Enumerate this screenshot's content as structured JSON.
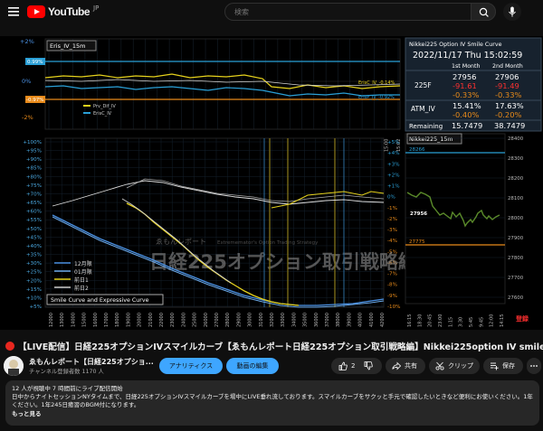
{
  "header": {
    "logo_text": "YouTube",
    "region": "JP",
    "search_placeholder": "検索"
  },
  "video": {
    "title": "【LIVE配信】日経225オプションIVスマイルカーブ【ゑもんレポート日経225オプション取引戦略編】Nikkei225option IV smile curve",
    "chart": {
      "top_label": "Eris_IV_15m",
      "top_axis": [
        "+2%",
        "0%",
        "-2%"
      ],
      "top_badge_blue": "0.99%",
      "top_badge_orange": "-0.97%",
      "top_line_label_c": "ErisC_IV_-0.14%",
      "top_line_label_p": "ErisP_IV_-0.92%",
      "top_legend": [
        "Prv_Dif_IV",
        "ErisC_IV"
      ],
      "time_labels": [
        "16:15",
        "17:00",
        "17:45",
        "18:30",
        "19:15",
        "20:00",
        "20:45",
        "21:30",
        "22:15",
        "23:00",
        "23:45",
        "0:30",
        "1:15",
        "2:00",
        "2:45",
        "3:30",
        "4:15",
        "5:00",
        "5:45",
        "6:30",
        "9:00",
        "9:45",
        "10:30",
        "11:15",
        "12:00",
        "13:00",
        "13:45",
        "14:30",
        "15:00",
        "15:02"
      ],
      "smile_label": "Smile Curve and Expressive Curve",
      "smile_left_axis": [
        "+100%",
        "+95%",
        "+90%",
        "+85%",
        "+80%",
        "+75%",
        "+70%",
        "+65%",
        "+60%",
        "+55%",
        "+50%",
        "+45%",
        "+40%",
        "+35%",
        "+30%",
        "+25%",
        "+20%",
        "+15%",
        "+10%",
        "+5%"
      ],
      "smile_right_axis": [
        "+5%",
        "+4%",
        "+3%",
        "+2%",
        "+1%",
        "0%",
        "-1%",
        "-2%",
        "-3%",
        "-4%",
        "-5%",
        "-6%",
        "-7%",
        "-8%",
        "-9%",
        "-10%"
      ],
      "strikes": [
        "12000",
        "13000",
        "14000",
        "15000",
        "16000",
        "17000",
        "18000",
        "19000",
        "20000",
        "21000",
        "22000",
        "23000",
        "24000",
        "25000",
        "26000",
        "27000",
        "28000",
        "29000",
        "30000",
        "31000",
        "32000",
        "33000",
        "34000",
        "35000",
        "36000",
        "37000",
        "38000",
        "39000",
        "40000",
        "41000",
        "42000"
      ],
      "legend": [
        "12月限",
        "01月限",
        "前日1",
        "前日2"
      ],
      "watermark_main": "日経225オプション取引戦略編",
      "watermark_sub": "ゑもんレポート",
      "watermark_en": "Extrememator's Option Trading Strategy",
      "table": {
        "title": "Nikkei225 Option IV Smile Curve",
        "datetime": "2022/11/17 Thu 15:02:59",
        "col1": "1st Month",
        "col2": "2nd Month",
        "row_225f_label": "225F",
        "f_price_1": "27956",
        "f_price_2": "27906",
        "f_chg_1": "-91.61",
        "f_chg_2": "-91.49",
        "f_pct_1": "-0.33%",
        "f_pct_2": "-0.33%",
        "row_atm_label": "ATM_IV",
        "atm_1": "15.41%",
        "atm_2": "17.63%",
        "atm_chg_1": "-0.40%",
        "atm_chg_2": "-0.20%",
        "row_rem_label": "Remaining",
        "rem_1": "15.7479",
        "rem_2": "38.7479"
      },
      "mini_label": "Nikkei225_15m",
      "mini_axis": [
        "28400",
        "28300",
        "28200",
        "28100",
        "28000",
        "27900",
        "27800",
        "27700",
        "27600"
      ],
      "mini_price": "27956",
      "mini_blue_level": "28266",
      "mini_orange_level": "27775",
      "mini_time_labels": [
        "16:15",
        "18:30",
        "20:45",
        "23:00",
        "1:15",
        "3:30",
        "5:45",
        "9:45",
        "12:00",
        "14:15"
      ],
      "mini_corner": "登録"
    }
  },
  "channel": {
    "name": "ゑもんレポート【日経225オプショ...",
    "subscribers": "チャンネル登録者数 1170 人",
    "analytics_label": "アナリティクス",
    "edit_label": "動画の編集"
  },
  "actions": {
    "like_count": "2",
    "share_label": "共有",
    "clip_label": "クリップ",
    "save_label": "保存"
  },
  "description": {
    "line1": "12 人が視聴中 7 時間前にライブ配信開始",
    "line2": "日中からナイトセッションNYタイムまで、日経225オプションIVスマイルカーブを場中にLIVE垂れ流しております。スマイルカーブをサクッと手元で確認したいときなど便利にお使いください。1年245日癒習のBGM付です。",
    "line3": "ください。1年245日癒習のBGM付になります。",
    "more": "もっと見る"
  },
  "colors": {
    "youtube_red": "#ff0000",
    "accent_blue": "#3ea6ff",
    "chart_yellow": "#e6d21c",
    "chart_cyan": "#2a9fd6",
    "chart_orange": "#e88a1a",
    "chart_green": "#5a8a2a",
    "negative_red": "#ff3030",
    "panel_bg": "#1e2a3a"
  }
}
